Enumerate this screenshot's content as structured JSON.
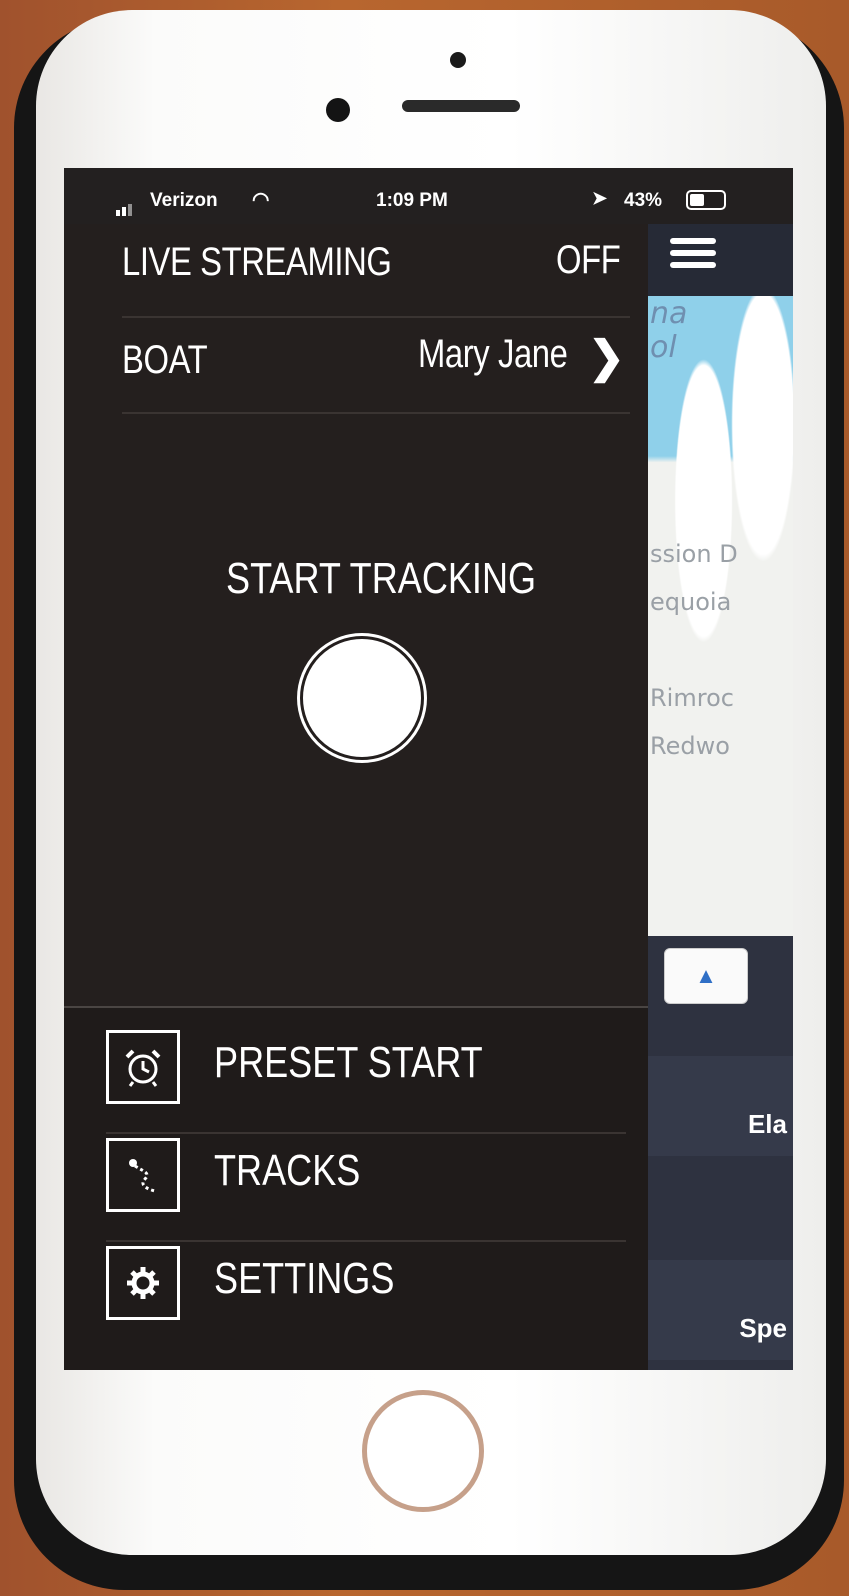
{
  "status_bar": {
    "carrier": "Verizon",
    "time": "1:09 PM",
    "battery": "43%",
    "battery_level": 0.43
  },
  "drawer": {
    "live_streaming": {
      "label": "LIVE STREAMING",
      "value": "OFF"
    },
    "boat": {
      "label": "BOAT",
      "value": "Mary Jane"
    },
    "start_tracking": "START TRACKING",
    "menu": [
      {
        "label": "PRESET START",
        "icon": "alarm-clock-icon"
      },
      {
        "label": "TRACKS",
        "icon": "track-path-icon"
      },
      {
        "label": "SETTINGS",
        "icon": "gear-icon"
      }
    ]
  },
  "map": {
    "labels": [
      "na",
      "ol",
      "ssion D",
      "equoia",
      "Rimroc",
      "Redwo"
    ],
    "rows": [
      "Ela",
      "Spe"
    ]
  },
  "colors": {
    "drawer_bg": "#241f1e",
    "map_water": "#8fd0ea",
    "map_panel": "#2e3240"
  }
}
